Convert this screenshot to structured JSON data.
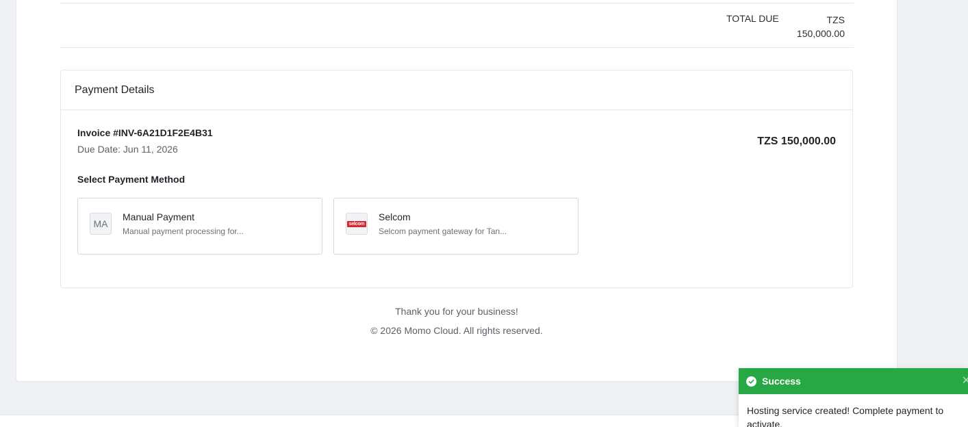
{
  "totals": {
    "label": "TOTAL DUE",
    "currency": "TZS",
    "amount": "150,000.00"
  },
  "payment": {
    "title": "Payment Details",
    "invoice_number": "Invoice #INV-6A21D1F2E4B31",
    "due_date": "Due Date: Jun 11, 2026",
    "amount": "TZS 150,000.00",
    "select_label": "Select Payment Method",
    "methods": [
      {
        "logo": "MA",
        "name": "Manual Payment",
        "description": "Manual payment processing for..."
      },
      {
        "logo": "selcom",
        "name": "Selcom",
        "description": "Selcom payment gateway for Tan..."
      }
    ]
  },
  "footer": {
    "thanks": "Thank you for your business!",
    "copyright": "© 2026 Momo Cloud. All rights reserved."
  },
  "toast": {
    "title": "Success",
    "message": "Hosting service created! Complete payment to activate.",
    "color": "#28a745",
    "icon": "check-circle-icon"
  }
}
